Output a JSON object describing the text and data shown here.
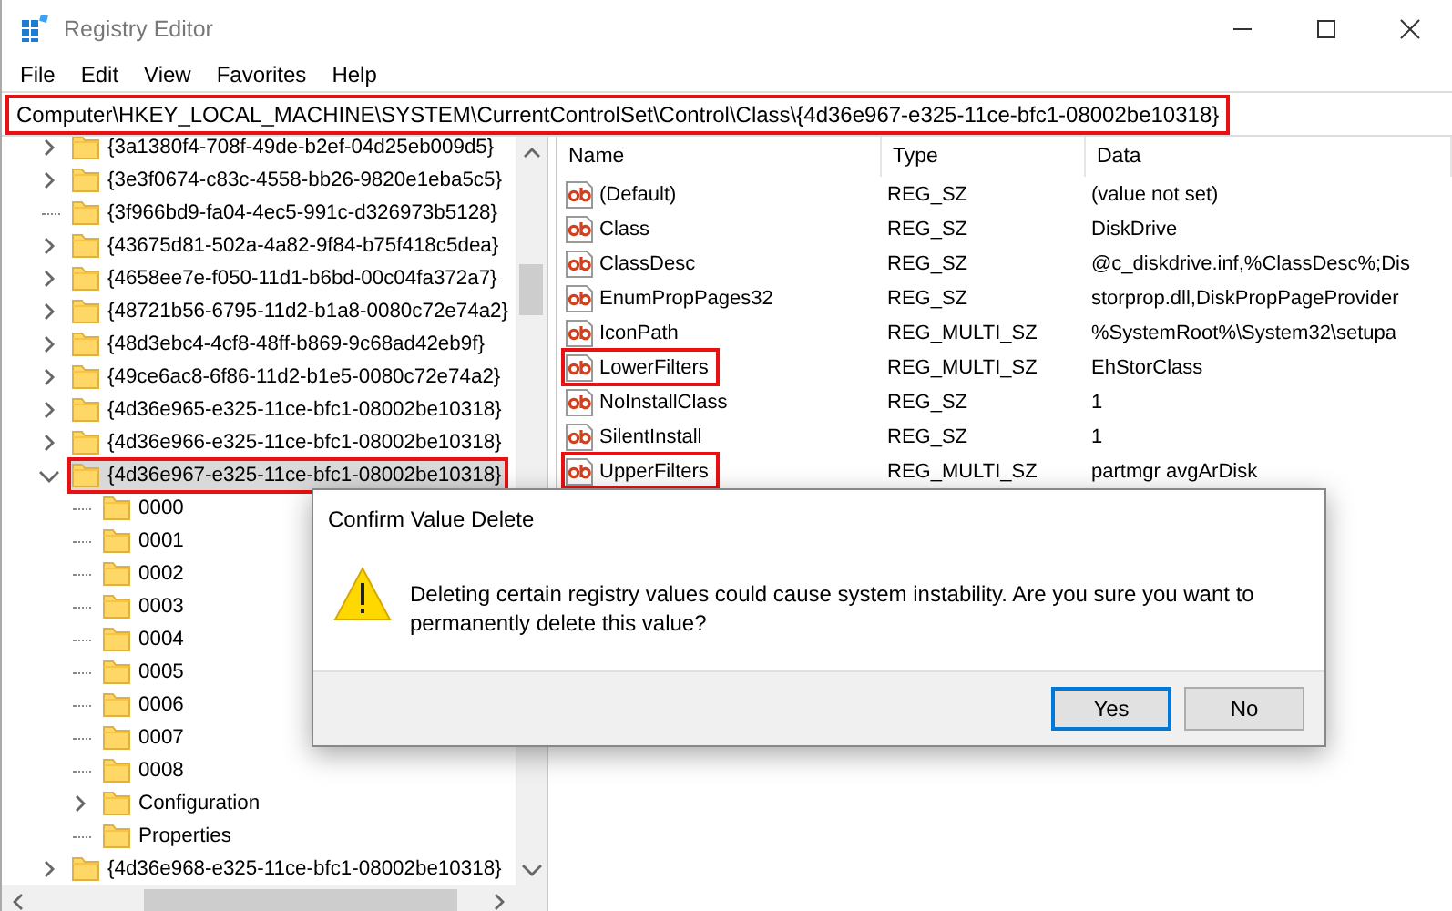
{
  "window": {
    "title": "Registry Editor"
  },
  "menu": [
    "File",
    "Edit",
    "View",
    "Favorites",
    "Help"
  ],
  "address": {
    "value": "Computer\\HKEY_LOCAL_MACHINE\\SYSTEM\\CurrentControlSet\\Control\\Class\\{4d36e967-e325-11ce-bfc1-08002be10318}",
    "highlighted": true
  },
  "tree": [
    {
      "label": "{3a1380f4-708f-49de-b2ef-04d25eb009d5}",
      "kind": "branch",
      "expanded": false,
      "selected": false,
      "highlighted": false
    },
    {
      "label": "{3e3f0674-c83c-4558-bb26-9820e1eba5c5}",
      "kind": "branch",
      "expanded": false,
      "selected": false,
      "highlighted": false
    },
    {
      "label": "{3f966bd9-fa04-4ec5-991c-d326973b5128}",
      "kind": "leaf",
      "selected": false,
      "highlighted": false
    },
    {
      "label": "{43675d81-502a-4a82-9f84-b75f418c5dea}",
      "kind": "branch",
      "expanded": false,
      "selected": false,
      "highlighted": false
    },
    {
      "label": "{4658ee7e-f050-11d1-b6bd-00c04fa372a7}",
      "kind": "branch",
      "expanded": false,
      "selected": false,
      "highlighted": false
    },
    {
      "label": "{48721b56-6795-11d2-b1a8-0080c72e74a2}",
      "kind": "branch",
      "expanded": false,
      "selected": false,
      "highlighted": false
    },
    {
      "label": "{48d3ebc4-4cf8-48ff-b869-9c68ad42eb9f}",
      "kind": "branch",
      "expanded": false,
      "selected": false,
      "highlighted": false
    },
    {
      "label": "{49ce6ac8-6f86-11d2-b1e5-0080c72e74a2}",
      "kind": "branch",
      "expanded": false,
      "selected": false,
      "highlighted": false
    },
    {
      "label": "{4d36e965-e325-11ce-bfc1-08002be10318}",
      "kind": "branch",
      "expanded": false,
      "selected": false,
      "highlighted": false
    },
    {
      "label": "{4d36e966-e325-11ce-bfc1-08002be10318}",
      "kind": "branch",
      "expanded": false,
      "selected": false,
      "highlighted": false
    },
    {
      "label": "{4d36e967-e325-11ce-bfc1-08002be10318}",
      "kind": "branch",
      "expanded": true,
      "selected": true,
      "highlighted": true,
      "children": [
        {
          "label": "0000",
          "kind": "leaf",
          "selected": false,
          "highlighted": false
        },
        {
          "label": "0001",
          "kind": "leaf",
          "selected": false,
          "highlighted": false
        },
        {
          "label": "0002",
          "kind": "leaf",
          "selected": false,
          "highlighted": false
        },
        {
          "label": "0003",
          "kind": "leaf",
          "selected": false,
          "highlighted": false
        },
        {
          "label": "0004",
          "kind": "leaf",
          "selected": false,
          "highlighted": false
        },
        {
          "label": "0005",
          "kind": "leaf",
          "selected": false,
          "highlighted": false
        },
        {
          "label": "0006",
          "kind": "leaf",
          "selected": false,
          "highlighted": false
        },
        {
          "label": "0007",
          "kind": "leaf",
          "selected": false,
          "highlighted": false
        },
        {
          "label": "0008",
          "kind": "leaf",
          "selected": false,
          "highlighted": false
        },
        {
          "label": "Configuration",
          "kind": "branch",
          "expanded": false,
          "selected": false,
          "highlighted": false
        },
        {
          "label": "Properties",
          "kind": "leaf",
          "selected": false,
          "highlighted": false
        }
      ]
    },
    {
      "label": "{4d36e968-e325-11ce-bfc1-08002be10318}",
      "kind": "branch",
      "expanded": false,
      "selected": false,
      "highlighted": false
    }
  ],
  "values": {
    "columns": [
      "Name",
      "Type",
      "Data"
    ],
    "rows": [
      {
        "name": "(Default)",
        "type": "REG_SZ",
        "data": "(value not set)",
        "highlighted": false
      },
      {
        "name": "Class",
        "type": "REG_SZ",
        "data": "DiskDrive",
        "highlighted": false
      },
      {
        "name": "ClassDesc",
        "type": "REG_SZ",
        "data": "@c_diskdrive.inf,%ClassDesc%;Dis",
        "highlighted": false
      },
      {
        "name": "EnumPropPages32",
        "type": "REG_SZ",
        "data": "storprop.dll,DiskPropPageProvider",
        "highlighted": false
      },
      {
        "name": "IconPath",
        "type": "REG_MULTI_SZ",
        "data": "%SystemRoot%\\System32\\setupa",
        "highlighted": false
      },
      {
        "name": "LowerFilters",
        "type": "REG_MULTI_SZ",
        "data": "EhStorClass",
        "highlighted": true
      },
      {
        "name": "NoInstallClass",
        "type": "REG_SZ",
        "data": "1",
        "highlighted": false
      },
      {
        "name": "SilentInstall",
        "type": "REG_SZ",
        "data": "1",
        "highlighted": false
      },
      {
        "name": "UpperFilters",
        "type": "REG_MULTI_SZ",
        "data": "partmgr avgArDisk",
        "highlighted": true
      }
    ]
  },
  "dialog": {
    "title": "Confirm Value Delete",
    "message": "Deleting certain registry values could cause system instability. Are you sure you want to permanently delete this value?",
    "buttons": [
      {
        "label": "Yes",
        "default": true
      },
      {
        "label": "No",
        "default": false
      }
    ]
  }
}
